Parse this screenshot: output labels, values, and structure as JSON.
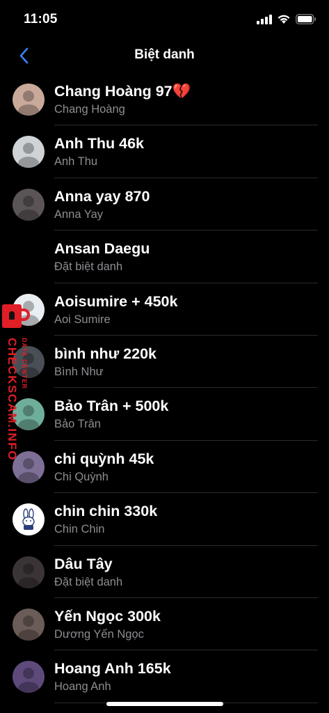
{
  "status_bar": {
    "time": "11:05"
  },
  "nav": {
    "title": "Biệt danh",
    "accent_color": "#3b82f6"
  },
  "nicknames": [
    {
      "nickname": "Chang Hoàng 97💔",
      "name": "Chang Hoàng",
      "avatar_color": "#c9a99a",
      "avatar_icon": "avatar-photo"
    },
    {
      "nickname": "Anh Thu 46k",
      "name": "Anh Thu",
      "avatar_color": "#cfd3d6",
      "avatar_icon": "avatar-photo"
    },
    {
      "nickname": "Anna yay 870",
      "name": "Anna Yay",
      "avatar_color": "#5a5456",
      "avatar_icon": "avatar-photo"
    },
    {
      "nickname": "Ansan Daegu",
      "name": "Đặt biệt danh",
      "avatar_color": "",
      "avatar_icon": "none"
    },
    {
      "nickname": "Aoisumire + 450k",
      "name": "Aoi Sumire",
      "avatar_color": "#e9eef2",
      "avatar_icon": "avatar-photo"
    },
    {
      "nickname": "bình như 220k",
      "name": "Bình Như",
      "avatar_color": "#4a4e55",
      "avatar_icon": "avatar-photo"
    },
    {
      "nickname": "Bảo Trân + 500k",
      "name": "Bảo Trân",
      "avatar_color": "#6fae9b",
      "avatar_icon": "avatar-photo"
    },
    {
      "nickname": "chi quỳnh 45k",
      "name": "Chi Quỳnh",
      "avatar_color": "#7d6f95",
      "avatar_icon": "avatar-photo"
    },
    {
      "nickname": "chin chin 330k",
      "name": "Chin Chin",
      "avatar_color": "#ffffff",
      "avatar_icon": "avatar-bunny"
    },
    {
      "nickname": "Dâu Tây",
      "name": "Đặt biệt danh",
      "avatar_color": "#3b3436",
      "avatar_icon": "avatar-photo"
    },
    {
      "nickname": "Yến Ngọc 300k",
      "name": "Dương Yến Ngọc",
      "avatar_color": "#6b5c57",
      "avatar_icon": "avatar-photo"
    },
    {
      "nickname": "Hoang Anh 165k",
      "name": "Hoang Anh",
      "avatar_color": "#5d4a7a",
      "avatar_icon": "avatar-photo"
    }
  ],
  "watermark": {
    "main": "CHECKSCAM.INFO",
    "sub": "DATA CENTER",
    "color": "#e01e26"
  }
}
